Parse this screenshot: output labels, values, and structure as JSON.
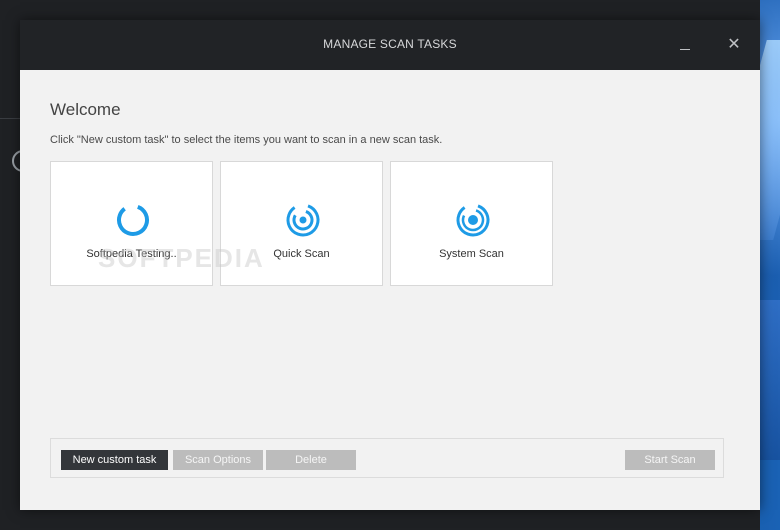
{
  "dialog": {
    "title": "MANAGE SCAN TASKS",
    "welcome": "Welcome",
    "instructions": "Click \"New custom task\" to select the items you want to scan in a new scan task."
  },
  "tasks": [
    {
      "label": "Softpedia Testing..",
      "icon": "scan-progress-icon"
    },
    {
      "label": "Quick Scan",
      "icon": "quick-scan-icon"
    },
    {
      "label": "System Scan",
      "icon": "system-scan-icon"
    }
  ],
  "watermark": "SOFTPEDIA",
  "toolbar": {
    "new_custom_task": "New custom task",
    "scan_options": "Scan Options",
    "delete": "Delete",
    "start_scan": "Start Scan"
  },
  "colors": {
    "accent": "#1e9be6",
    "titlebar": "#212326",
    "primary_button": "#33363a",
    "disabled_button": "#bcbcbc"
  }
}
